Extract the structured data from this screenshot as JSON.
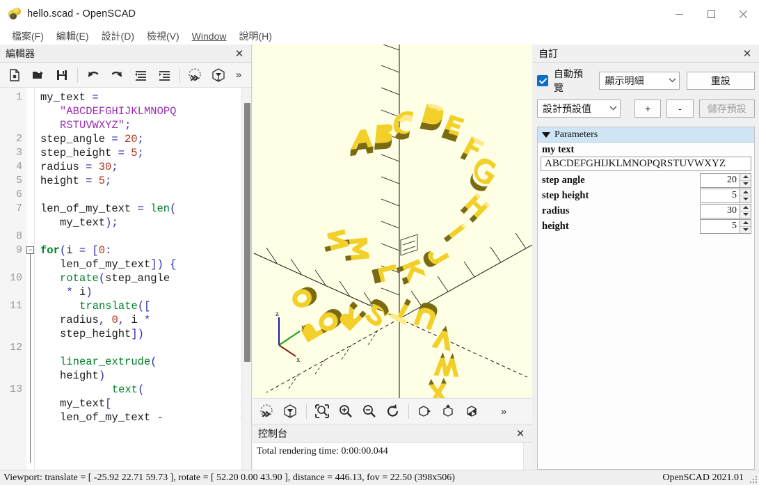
{
  "window": {
    "title": "hello.scad - OpenSCAD",
    "icon": "openscad-logo-icon",
    "minimize": "—",
    "maximize": "□",
    "close": "✕"
  },
  "menubar": {
    "items": [
      {
        "label": "檔案(F)",
        "mnemonic": "F"
      },
      {
        "label": "編輯(E)",
        "mnemonic": "E"
      },
      {
        "label": "設計(D)",
        "mnemonic": "D"
      },
      {
        "label": "檢視(V)",
        "mnemonic": "V"
      },
      {
        "label": "Window",
        "mnemonic": "W"
      },
      {
        "label": "說明(H)",
        "mnemonic": "H"
      }
    ]
  },
  "editor": {
    "title": "編輯器",
    "close_label": "✕",
    "toolbar": [
      {
        "name": "new-file-button",
        "tip": "New"
      },
      {
        "name": "open-file-button",
        "tip": "Open"
      },
      {
        "name": "save-file-button",
        "tip": "Save"
      },
      {
        "name": "undo-button",
        "tip": "Undo"
      },
      {
        "name": "redo-button",
        "tip": "Redo"
      },
      {
        "name": "unindent-button",
        "tip": "Unindent"
      },
      {
        "name": "indent-button",
        "tip": "Indent"
      },
      {
        "name": "preview-button",
        "tip": "Preview"
      },
      {
        "name": "render-button",
        "tip": "Render"
      }
    ],
    "overflow_label": "»",
    "code_lines": [
      {
        "num": "1",
        "segments": [
          [
            "var",
            "my_text "
          ],
          [
            "pun",
            "= "
          ]
        ],
        "wrap": true
      },
      {
        "num": "",
        "indent": 3,
        "segments": [
          [
            "str",
            "\"ABCDEFGHIJKLMNOPQ"
          ]
        ],
        "wrap": true
      },
      {
        "num": "",
        "indent": 3,
        "segments": [
          [
            "str",
            "RSTUVWXYZ\""
          ],
          [
            "pun",
            ";"
          ]
        ]
      },
      {
        "num": "2",
        "segments": [
          [
            "var",
            "step_angle "
          ],
          [
            "pun",
            "= "
          ],
          [
            "num",
            "20"
          ],
          [
            "pun",
            ";"
          ]
        ]
      },
      {
        "num": "3",
        "segments": [
          [
            "var",
            "step_height "
          ],
          [
            "pun",
            "= "
          ],
          [
            "num",
            "5"
          ],
          [
            "pun",
            ";"
          ]
        ]
      },
      {
        "num": "4",
        "segments": [
          [
            "var",
            "radius "
          ],
          [
            "pun",
            "= "
          ],
          [
            "num",
            "30"
          ],
          [
            "pun",
            ";"
          ]
        ]
      },
      {
        "num": "5",
        "segments": [
          [
            "var",
            "height "
          ],
          [
            "pun",
            "= "
          ],
          [
            "num",
            "5"
          ],
          [
            "pun",
            ";"
          ]
        ]
      },
      {
        "num": "6",
        "segments": []
      },
      {
        "num": "7",
        "segments": [
          [
            "var",
            "len_of_my_text "
          ],
          [
            "pun",
            "= "
          ],
          [
            "fn",
            "len"
          ],
          [
            "pun",
            "("
          ]
        ],
        "wrap": true
      },
      {
        "num": "",
        "indent": 3,
        "segments": [
          [
            "var",
            "my_text"
          ],
          [
            "pun",
            ");"
          ]
        ]
      },
      {
        "num": "8",
        "segments": []
      },
      {
        "num": "9",
        "segments": [
          [
            "kw",
            "for"
          ],
          [
            "pun",
            "("
          ],
          [
            "var",
            "i "
          ],
          [
            "pun",
            "= ["
          ],
          [
            "num",
            "0"
          ],
          [
            "pun",
            ":"
          ]
        ],
        "wrap": true,
        "fold": true
      },
      {
        "num": "",
        "indent": 3,
        "segments": [
          [
            "var",
            "len_of_my_text"
          ],
          [
            "pun",
            "]) {"
          ]
        ]
      },
      {
        "num": "10",
        "indent": 3,
        "segments": [
          [
            "fn",
            "rotate"
          ],
          [
            "pun",
            "("
          ],
          [
            "var",
            "step_angle"
          ]
        ],
        "wrap": true
      },
      {
        "num": "",
        "indent": 4,
        "segments": [
          [
            "pun",
            "* "
          ],
          [
            "var",
            "i"
          ],
          [
            "pun",
            ")"
          ]
        ]
      },
      {
        "num": "11",
        "indent": 6,
        "segments": [
          [
            "fn",
            "translate"
          ],
          [
            "pun",
            "(["
          ]
        ],
        "wrap": true
      },
      {
        "num": "",
        "indent": 3,
        "segments": [
          [
            "var",
            "radius"
          ],
          [
            "pun",
            ", "
          ],
          [
            "num",
            "0"
          ],
          [
            "pun",
            ", "
          ],
          [
            "var",
            "i "
          ],
          [
            "pun",
            "*"
          ]
        ],
        "wrap": true
      },
      {
        "num": "",
        "indent": 3,
        "segments": [
          [
            "var",
            "step_height"
          ],
          [
            "pun",
            "])"
          ]
        ]
      },
      {
        "num": "12",
        "segments": [],
        "wrap": true
      },
      {
        "num": "",
        "indent": 3,
        "segments": [
          [
            "fn",
            "linear_extrude"
          ],
          [
            "pun",
            "("
          ]
        ],
        "wrap": true
      },
      {
        "num": "",
        "indent": 3,
        "segments": [
          [
            "var",
            "height"
          ],
          [
            "pun",
            ")"
          ]
        ]
      },
      {
        "num": "13",
        "indent": 11,
        "segments": [
          [
            "fn",
            "text"
          ],
          [
            "pun",
            "("
          ]
        ],
        "wrap": true
      },
      {
        "num": "",
        "indent": 3,
        "segments": [
          [
            "var",
            "my_text"
          ],
          [
            "pun",
            "["
          ]
        ],
        "wrap": true
      },
      {
        "num": "",
        "indent": 3,
        "segments": [
          [
            "var",
            "len_of_my_text "
          ],
          [
            "pun",
            "-"
          ]
        ],
        "wrap": true
      }
    ]
  },
  "viewport": {
    "background_color": "#ffffe5",
    "model_color": "#f9d72c",
    "axis": {
      "x_label": "x",
      "y_label": "y",
      "z_label": "z",
      "x_color": "#8b1a1a",
      "y_color": "#16a016",
      "z_color": "#1a1aa0"
    },
    "toolbar": [
      {
        "name": "preview-button",
        "tip": "Preview"
      },
      {
        "name": "render-button",
        "tip": "Render"
      },
      {
        "name": "zoom-fit-button",
        "tip": "View All"
      },
      {
        "name": "zoom-in-button",
        "tip": "Zoom In"
      },
      {
        "name": "zoom-out-button",
        "tip": "Zoom Out"
      },
      {
        "name": "reset-view-button",
        "tip": "Reset View"
      },
      {
        "name": "right-view-button",
        "tip": "Right View"
      },
      {
        "name": "top-view-button",
        "tip": "Top View"
      },
      {
        "name": "diagonal-view-button",
        "tip": "Diagonal View"
      }
    ],
    "overflow_label": "»"
  },
  "console": {
    "title": "控制台",
    "close_label": "✕",
    "lines": [
      "Total rendering time: 0:00:00.044"
    ]
  },
  "customizer": {
    "title": "自訂",
    "close_label": "✕",
    "auto_preview_label": "自動預覽",
    "auto_preview_checked": true,
    "detail_select": "顯示明細",
    "reset_button": "重設",
    "preset_select": "設計預設值",
    "add_button": "+",
    "remove_button": "-",
    "save_preset_button": "儲存預設",
    "save_preset_disabled": true,
    "group_label": "Parameters",
    "group_expanded": true,
    "text_param": {
      "name": "my text",
      "value": "ABCDEFGHIJKLMNOPQRSTUVWXYZ"
    },
    "number_params": [
      {
        "name": "step angle",
        "value": "20"
      },
      {
        "name": "step height",
        "value": "5"
      },
      {
        "name": "radius",
        "value": "30"
      },
      {
        "name": "height",
        "value": "5"
      }
    ]
  },
  "statusbar": {
    "viewport_info": "Viewport: translate = [ -25.92 22.71 59.73 ], rotate = [ 52.20 0.00 43.90 ], distance = 446.13, fov = 22.50 (398x506)",
    "version": "OpenSCAD 2021.01"
  }
}
